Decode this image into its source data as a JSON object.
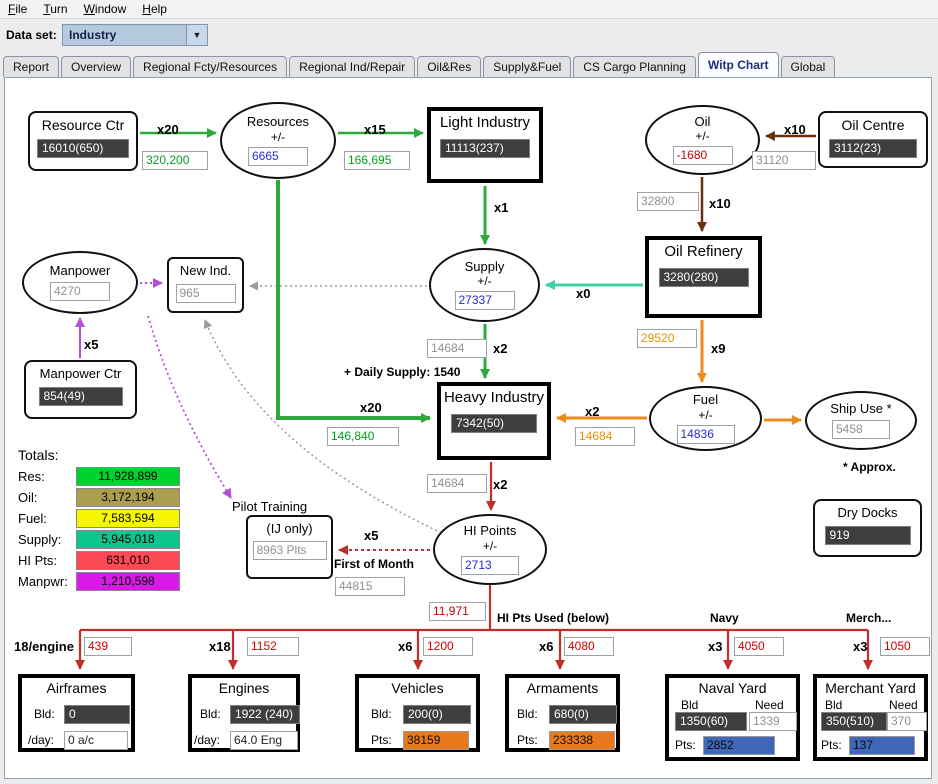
{
  "menu": {
    "items": [
      {
        "label": "File"
      },
      {
        "label": "Turn"
      },
      {
        "label": "Window"
      },
      {
        "label": "Help"
      }
    ]
  },
  "toolbar": {
    "dataset_label": "Data set:",
    "dataset_value": "Industry"
  },
  "tabs": [
    {
      "label": "Report"
    },
    {
      "label": "Overview"
    },
    {
      "label": "Regional Fcty/Resources"
    },
    {
      "label": "Regional Ind/Repair"
    },
    {
      "label": "Oil&Res"
    },
    {
      "label": "Supply&Fuel"
    },
    {
      "label": "CS Cargo Planning"
    },
    {
      "label": "Witp Chart"
    },
    {
      "label": "Global"
    }
  ],
  "nodes": {
    "resource_ctr": {
      "title": "Resource Ctr",
      "value": "16010(650)"
    },
    "resources": {
      "title": "Resources",
      "sub": "+/-",
      "value": "6665"
    },
    "light_industry": {
      "title": "Light Industry",
      "value": "11113(237)"
    },
    "oil": {
      "title": "Oil",
      "sub": "+/-",
      "value": "-1680"
    },
    "oil_centre": {
      "title": "Oil Centre",
      "value": "3112(23)"
    },
    "oil_refinery": {
      "title": "Oil Refinery",
      "value": "3280(280)"
    },
    "supply": {
      "title": "Supply",
      "sub": "+/-",
      "value": "27337"
    },
    "manpower": {
      "title": "Manpower",
      "value": "4270"
    },
    "new_ind": {
      "title": "New Ind.",
      "value": "965"
    },
    "manpower_ctr": {
      "title": "Manpower Ctr",
      "value": "854(49)"
    },
    "heavy_industry": {
      "title": "Heavy Industry",
      "value": "7342(50)"
    },
    "fuel": {
      "title": "Fuel",
      "sub": "+/-",
      "value": "14836"
    },
    "ship_use": {
      "title": "Ship Use *",
      "value": "5458"
    },
    "pilot_training": {
      "title": "Pilot Training",
      "sub": "(IJ only)",
      "value": "8963 Plts"
    },
    "hi_points": {
      "title": "HI Points",
      "sub": "+/-",
      "value": "2713"
    },
    "dry_docks": {
      "title": "Dry Docks",
      "value": "919"
    }
  },
  "flows": {
    "res_ctr_to_resources": {
      "mult": "x20",
      "value": "320,200"
    },
    "resources_to_light": {
      "mult": "x15",
      "value": "166,695"
    },
    "light_to_supply": {
      "mult": "x1"
    },
    "oil_centre_to_oil": {
      "mult": "x10",
      "value": "31120"
    },
    "oil_to_refinery": {
      "mult": "x10",
      "value": "32800"
    },
    "refinery_to_supply": {
      "mult": "x0"
    },
    "refinery_to_fuel": {
      "mult": "x9",
      "value": "29520"
    },
    "fuel_to_heavy": {
      "mult": "x2",
      "value": "14684"
    },
    "supply_to_heavy": {
      "mult": "x2",
      "value": "14684"
    },
    "resources_to_heavy": {
      "mult": "x20",
      "value": "146,840"
    },
    "heavy_to_hipoints": {
      "mult": "x2",
      "value": "14684"
    },
    "manpower_ctr_to_manpower": {
      "mult": "x5"
    },
    "hipoints_to_pilot": {
      "mult": "x5",
      "value": "44815"
    },
    "hipoints_used": {
      "value": "11,971"
    },
    "airframes": {
      "mult": "18/engine",
      "value": "439"
    },
    "engines": {
      "mult": "x18",
      "value": "1152"
    },
    "vehicles": {
      "mult": "x6",
      "value": "1200"
    },
    "armaments": {
      "mult": "x6",
      "value": "4080"
    },
    "naval": {
      "mult": "x3",
      "value": "4050"
    },
    "merchant": {
      "mult": "x3",
      "value": "1050"
    }
  },
  "annotations": {
    "daily_supply": "+ Daily Supply: 1540",
    "first_of_month": "First of Month",
    "hi_pts_used": "HI Pts Used (below)",
    "navy": "Navy",
    "merch": "Merch...",
    "approx": "* Approx."
  },
  "totals": {
    "title": "Totals:",
    "rows": [
      {
        "label": "Res:",
        "value": "11,928,899",
        "color": "#00d22e"
      },
      {
        "label": "Oil:",
        "value": "3,172,194",
        "color": "#ab9f4e"
      },
      {
        "label": "Fuel:",
        "value": "7,583,594",
        "color": "#f6f600"
      },
      {
        "label": "Supply:",
        "value": "5,945,018",
        "color": "#0cc68e"
      },
      {
        "label": "HI Pts:",
        "value": "631,010",
        "color": "#fb4a55"
      },
      {
        "label": "Manpwr:",
        "value": "1,210,598",
        "color": "#da19e6"
      }
    ]
  },
  "factories": {
    "airframes": {
      "title": "Airframes",
      "r1_label": "Bld:",
      "r1_value": "0",
      "r2_label": "/day:",
      "r2_value": "0 a/c"
    },
    "engines": {
      "title": "Engines",
      "r1_label": "Bld:",
      "r1_value": "1922 (240)",
      "r2_label": "/day:",
      "r2_value": "64.0 Eng"
    },
    "vehicles": {
      "title": "Vehicles",
      "r1_label": "Bld:",
      "r1_value": "200(0)",
      "r2_label": "Pts:",
      "r2_value": "38159"
    },
    "armaments": {
      "title": "Armaments",
      "r1_label": "Bld:",
      "r1_value": "680(0)",
      "r2_label": "Pts:",
      "r2_value": "233338"
    },
    "naval_yard": {
      "title": "Naval Yard",
      "h1": "Bld",
      "h2": "Need",
      "bld": "1350(60)",
      "need": "1339",
      "pts_label": "Pts:",
      "pts": "2852"
    },
    "merchant_yard": {
      "title": "Merchant Yard",
      "h1": "Bld",
      "h2": "Need",
      "bld": "350(510)",
      "need": "370",
      "pts_label": "Pts:",
      "pts": "137"
    }
  },
  "colors": {
    "arrow_green": "#2fa83c",
    "arrow_teal": "#3fd0a6",
    "arrow_oil": "#6e2f0e",
    "arrow_orange": "#ee8a1c",
    "arrow_purple": "#b44fd8",
    "arrow_gray": "#9a9a9a",
    "arrow_red": "#c03028",
    "pts_orange": "#e8791d",
    "pts_blue": "#4068b8"
  }
}
